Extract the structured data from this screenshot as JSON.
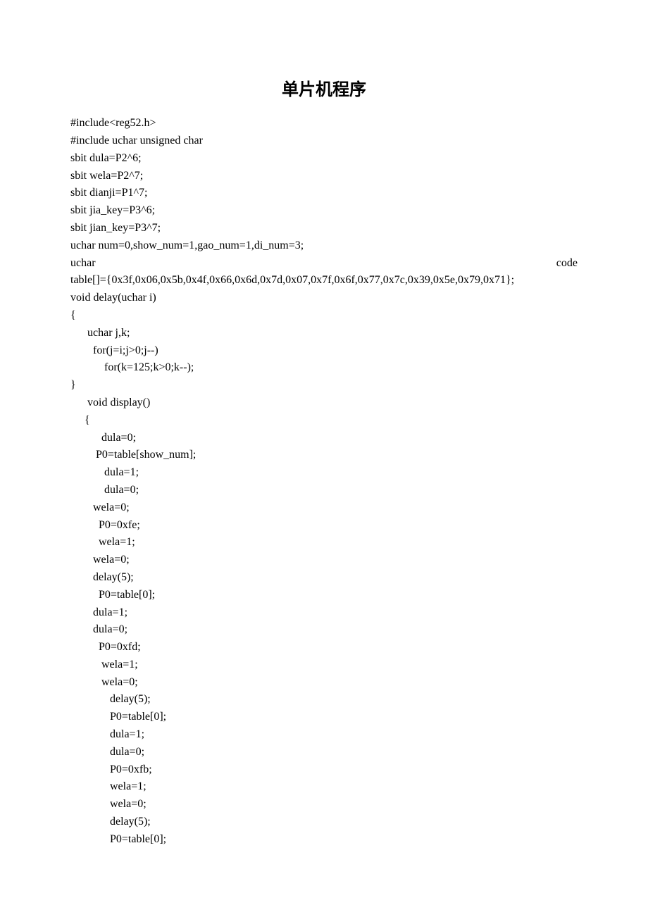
{
  "title": "单片机程序",
  "code_before_justify": "#include<reg52.h>\n#include uchar unsigned char\nsbit dula=P2^6;\nsbit wela=P2^7;\nsbit dianji=P1^7;\nsbit jia_key=P3^6;\nsbit jian_key=P3^7;\nuchar num=0,show_num=1,gao_num=1,di_num=3;",
  "uchar_left": "uchar",
  "uchar_right": "code",
  "table_line": "table[]={0x3f,0x06,0x5b,0x4f,0x66,0x6d,0x7d,0x07,0x7f,0x6f,0x77,0x7c,0x39,0x5e,0x79,0x71};",
  "code_after": "void delay(uchar i)\n{\n      uchar j,k;\n        for(j=i;j>0;j--)\n            for(k=125;k>0;k--);\n}\n      void display()\n     {\n           dula=0;\n         P0=table[show_num];\n            dula=1;\n            dula=0;\n        wela=0;\n          P0=0xfe;\n          wela=1;\n        wela=0;\n        delay(5);\n          P0=table[0];\n        dula=1;\n        dula=0;\n          P0=0xfd;\n           wela=1;\n           wela=0;\n              delay(5);\n              P0=table[0];\n              dula=1;\n              dula=0;\n              P0=0xfb;\n              wela=1;\n              wela=0;\n              delay(5);\n              P0=table[0];"
}
